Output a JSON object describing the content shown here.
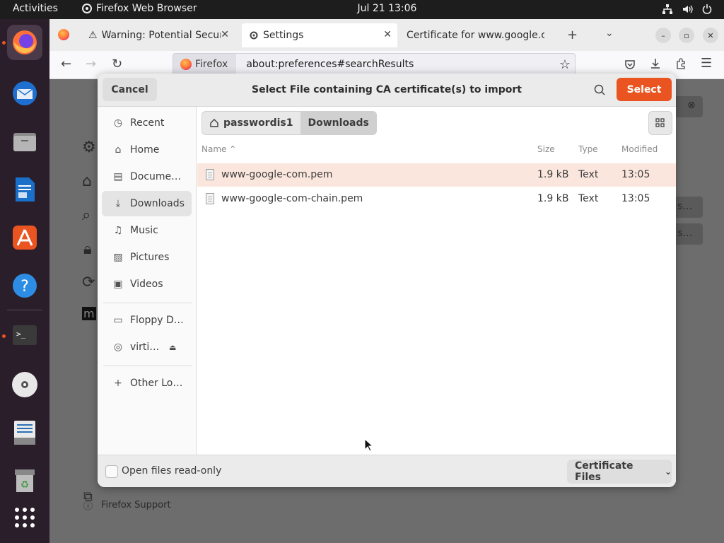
{
  "topbar": {
    "activities": "Activities",
    "app_name": "Firefox Web Browser",
    "clock": "Jul 21  13:06"
  },
  "dock": {
    "items": [
      "firefox-icon",
      "thunderbird-icon",
      "files-icon",
      "writer-icon",
      "app-center-icon",
      "help-icon",
      "terminal-icon",
      "disc-icon",
      "text-editor-icon",
      "trash-icon",
      "app-grid-icon"
    ],
    "accent": "#e95420"
  },
  "browser": {
    "tabs": [
      {
        "label": "Warning: Potential Security Risk Ahead",
        "icon": "warning-icon"
      },
      {
        "label": "Settings",
        "icon": "gear-icon"
      },
      {
        "label": "Certificate for www.google.com",
        "icon": ""
      }
    ],
    "identity_label": "Firefox",
    "url": "about:preferences#searchResults"
  },
  "dialog": {
    "title": "Select File containing CA certificate(s) to import",
    "cancel_label": "Cancel",
    "select_label": "Select",
    "places": [
      {
        "label": "Recent",
        "icon": "clock-icon"
      },
      {
        "label": "Home",
        "icon": "home-icon"
      },
      {
        "label": "Docume…",
        "icon": "document-icon"
      },
      {
        "label": "Downloads",
        "icon": "download-icon"
      },
      {
        "label": "Music",
        "icon": "music-icon"
      },
      {
        "label": "Pictures",
        "icon": "picture-icon"
      },
      {
        "label": "Videos",
        "icon": "video-icon"
      },
      {
        "label": "Floppy D…",
        "icon": "floppy-icon"
      },
      {
        "label": "virti…",
        "icon": "disc-icon"
      },
      {
        "label": "Other Lo…",
        "icon": "plus-icon"
      }
    ],
    "path": [
      "passwordis1",
      "Downloads"
    ],
    "columns": {
      "name": "Name",
      "size": "Size",
      "type": "Type",
      "modified": "Modified"
    },
    "files": [
      {
        "name": "www-google-com.pem",
        "size": "1.9 kB",
        "type": "Text",
        "modified": "13:05"
      },
      {
        "name": "www-google-com-chain.pem",
        "size": "1.9 kB",
        "type": "Text",
        "modified": "13:05"
      }
    ],
    "readonly_label": "Open files read-only",
    "filter_label": "Certificate Files"
  },
  "settings_bg": {
    "support_label": "Firefox Support"
  }
}
